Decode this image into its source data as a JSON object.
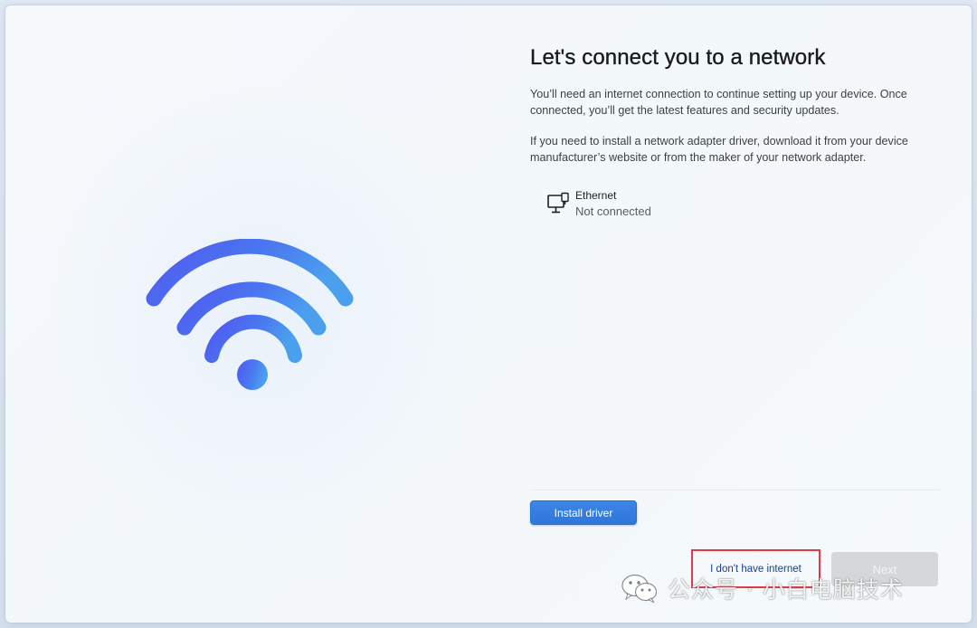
{
  "page": {
    "title": "Let's connect you to a network",
    "paragraph1": "You’ll need an internet connection to continue setting up your device. Once connected, you’ll get the latest features and security updates.",
    "paragraph2": "If you need to install a network adapter driver, download it from your device manufacturer’s website or from the maker of your network adapter."
  },
  "networks": [
    {
      "icon": "ethernet-monitor-icon",
      "name": "Ethernet",
      "status": "Not connected"
    }
  ],
  "buttons": {
    "install_driver": "Install driver",
    "no_internet": "I don't have internet",
    "next": "Next"
  },
  "illustration": {
    "icon": "wifi-icon",
    "colors": {
      "start": "#4f5df0",
      "end": "#4a93ef"
    }
  },
  "watermark": {
    "icon": "wechat-icon",
    "text": "公众号 · 小白电脑技术"
  },
  "colors": {
    "accent": "#2f76da",
    "highlight_border": "#e0394a",
    "disabled_button": "#d5d7d9"
  }
}
